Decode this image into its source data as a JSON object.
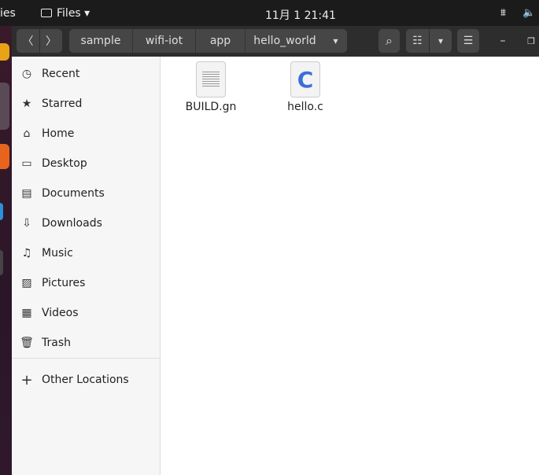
{
  "topbar": {
    "activities": "ies",
    "app_menu": "Files ▾",
    "clock": "11月 1  21:41"
  },
  "header": {
    "back": "〈",
    "forward": "〉",
    "breadcrumbs": [
      "sample",
      "wifi-iot",
      "app",
      "hello_world"
    ],
    "crumb_menu": "▾",
    "search": "⌕",
    "view_toggle": "☷",
    "view_menu": "▾",
    "hamburger": "☰",
    "minimize": "–",
    "maximize": "❐"
  },
  "sidebar": {
    "items": [
      {
        "icon": "clock-icon",
        "glyph": "◷",
        "label": "Recent"
      },
      {
        "icon": "star-icon",
        "glyph": "★",
        "label": "Starred"
      },
      {
        "icon": "home-icon",
        "glyph": "⌂",
        "label": "Home"
      },
      {
        "icon": "desktop-icon",
        "glyph": "▭",
        "label": "Desktop"
      },
      {
        "icon": "documents-icon",
        "glyph": "▤",
        "label": "Documents"
      },
      {
        "icon": "downloads-icon",
        "glyph": "⇩",
        "label": "Downloads"
      },
      {
        "icon": "music-icon",
        "glyph": "♫",
        "label": "Music"
      },
      {
        "icon": "pictures-icon",
        "glyph": "▨",
        "label": "Pictures"
      },
      {
        "icon": "videos-icon",
        "glyph": "▦",
        "label": "Videos"
      },
      {
        "icon": "trash-icon",
        "glyph": "🗑",
        "label": "Trash"
      }
    ],
    "other": {
      "glyph": "+",
      "label": "Other Locations"
    }
  },
  "files": [
    {
      "name": "BUILD.gn",
      "type": "text"
    },
    {
      "name": "hello.c",
      "type": "c-source",
      "glyph": "C"
    }
  ],
  "colors": {
    "c_icon": "#3b6fd8"
  }
}
